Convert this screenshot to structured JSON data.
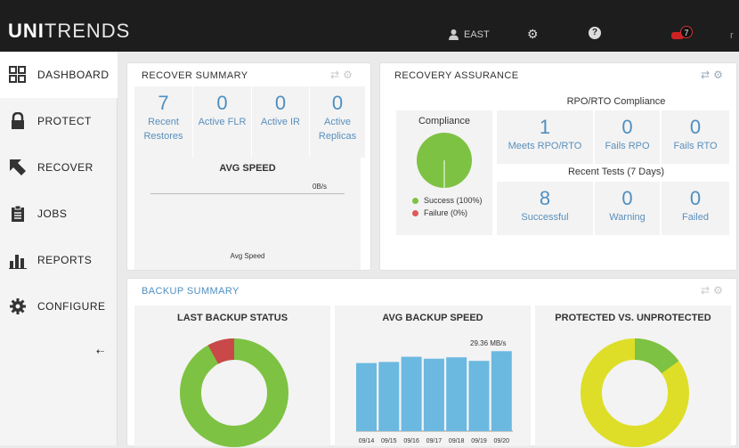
{
  "header": {
    "logo_bold": "UNI",
    "logo_rest": "TRENDS",
    "user": "EAST",
    "settings_glyph": "⚙",
    "help_glyph": "?",
    "alert_count": "7",
    "edge_text": "r"
  },
  "sidebar": {
    "items": [
      {
        "label": "DASHBOARD",
        "icon": "dashboard-icon",
        "glyph": "▦"
      },
      {
        "label": "PROTECT",
        "icon": "lock-icon",
        "glyph": "🔒"
      },
      {
        "label": "RECOVER",
        "icon": "recover-arrow-icon",
        "glyph": "◤"
      },
      {
        "label": "JOBS",
        "icon": "clipboard-icon",
        "glyph": "▤"
      },
      {
        "label": "REPORTS",
        "icon": "bar-chart-icon",
        "glyph": "▟"
      },
      {
        "label": "CONFIGURE",
        "icon": "gear-icon",
        "glyph": "⚙"
      }
    ],
    "collapse_glyph": "⇠"
  },
  "recover_summary": {
    "title": "RECOVER SUMMARY",
    "tiles": [
      {
        "value": "7",
        "label1": "Recent",
        "label2": "Restores"
      },
      {
        "value": "0",
        "label1": "Active FLR",
        "label2": ""
      },
      {
        "value": "0",
        "label1": "Active IR",
        "label2": ""
      },
      {
        "value": "0",
        "label1": "Active",
        "label2": "Replicas"
      }
    ],
    "avg_speed_title": "AVG SPEED",
    "avg_speed_value": "0B/s",
    "avg_speed_caption": "Avg Speed"
  },
  "recovery_assurance": {
    "title": "RECOVERY ASSURANCE",
    "compliance_heading": "RPO/RTO Compliance",
    "compliance_label": "Compliance",
    "legend": [
      {
        "label": "Success (100%)",
        "color": "#7dc242"
      },
      {
        "label": "Failure (0%)",
        "color": "#e05a5a"
      }
    ],
    "compliance_tiles": [
      {
        "value": "1",
        "label": "Meets RPO/RTO"
      },
      {
        "value": "0",
        "label": "Fails RPO"
      },
      {
        "value": "0",
        "label": "Fails RTO"
      }
    ],
    "tests_heading": "Recent Tests (7 Days)",
    "test_tiles": [
      {
        "value": "8",
        "label": "Successful"
      },
      {
        "value": "0",
        "label": "Warning"
      },
      {
        "value": "0",
        "label": "Failed"
      }
    ],
    "compliance_pct": 100
  },
  "backup_summary": {
    "title": "BACKUP SUMMARY",
    "last_status_title": "LAST BACKUP STATUS",
    "avg_speed_title": "AVG BACKUP SPEED",
    "avg_speed_max_label": "29.36 MB/s",
    "protected_title": "PROTECTED VS. UNPROTECTED",
    "last_status_success_fraction": 0.92,
    "protected_fraction": 0.85
  },
  "chart_data": {
    "type": "bar",
    "categories": [
      "09/14",
      "09/15",
      "09/16",
      "09/17",
      "09/18",
      "09/19",
      "09/20"
    ],
    "values": [
      25.0,
      25.4,
      27.3,
      26.6,
      27.1,
      25.8,
      29.36
    ],
    "ylim": [
      0,
      36
    ]
  },
  "colors": {
    "accent": "#4f8fc0",
    "green": "#7dc242",
    "red": "#c94848",
    "yellow": "#dede28",
    "bar": "#6bb8e0"
  }
}
